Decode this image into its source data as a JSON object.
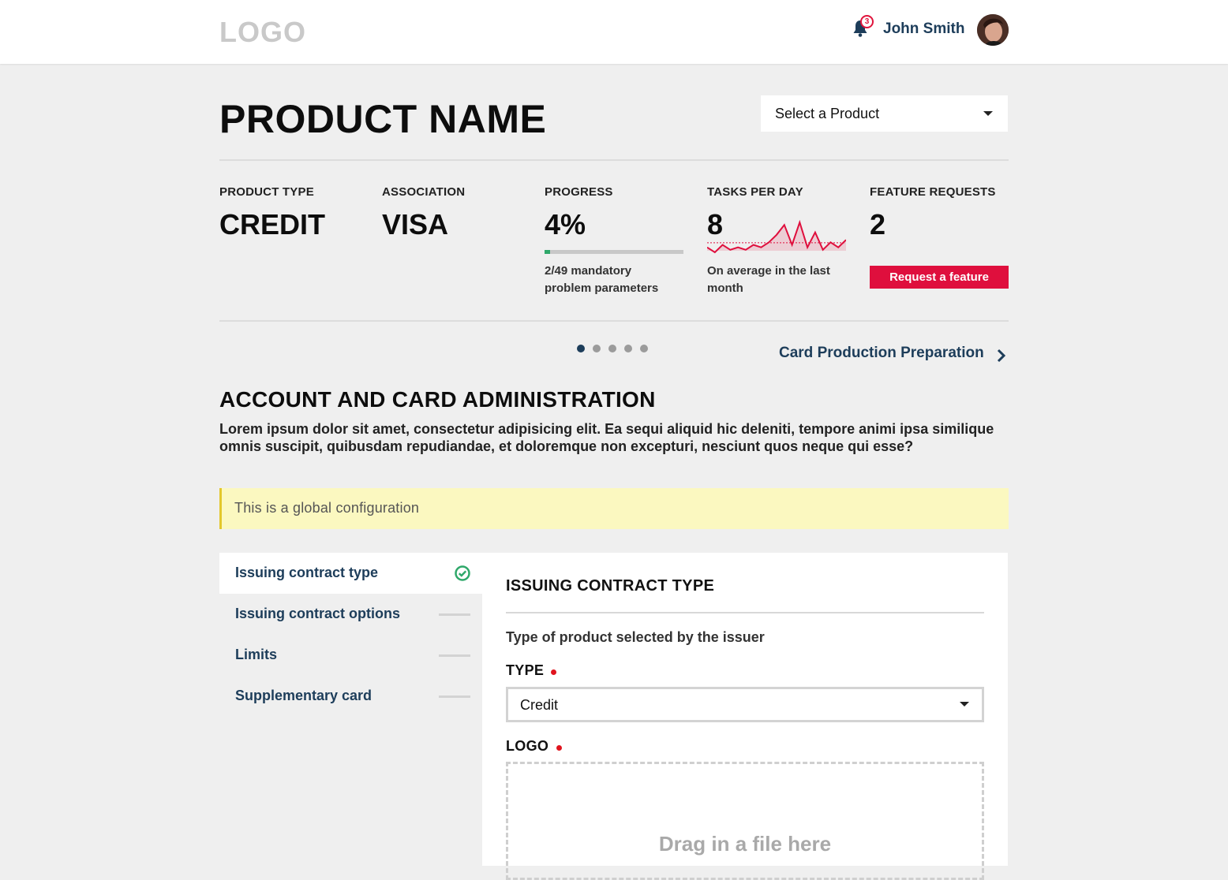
{
  "header": {
    "logo": "LOGO",
    "notification_count": "3",
    "username": "John Smith"
  },
  "product": {
    "title": "PRODUCT NAME",
    "select_label": "Select a Product"
  },
  "stats": {
    "product_type": {
      "label": "PRODUCT TYPE",
      "value": "CREDIT"
    },
    "association": {
      "label": "ASSOCIATION",
      "value": "VISA"
    },
    "progress": {
      "label": "PROGRESS",
      "value": "4%",
      "fraction": 0.04,
      "note_line1": "2/49 mandatory",
      "note_line2": "problem parameters"
    },
    "tasks": {
      "label": "TASKS PER DAY",
      "value": "8",
      "note_line1": "On average in the last",
      "note_line2": "month",
      "sparkline": [
        3,
        1,
        4,
        2,
        3,
        2,
        4,
        3,
        5,
        8,
        12,
        4,
        13,
        3,
        9,
        2,
        5,
        3,
        6
      ]
    },
    "features": {
      "label": "FEATURE REQUESTS",
      "value": "2",
      "button": "Request a feature"
    }
  },
  "pager": {
    "dot_count": 5,
    "active_index": 0,
    "next_label": "Card Production Preparation"
  },
  "section": {
    "title": "ACCOUNT AND CARD ADMINISTRATION",
    "description": "Lorem ipsum dolor sit amet, consectetur adipisicing elit. Ea sequi aliquid hic deleniti, tempore animi ipsa similique omnis suscipit, quibusdam repudiandae, et doloremque non excepturi, nesciunt quos neque qui esse?",
    "notice": "This is a global configuration"
  },
  "steps": [
    {
      "label": "Issuing contract type",
      "status": "complete"
    },
    {
      "label": "Issuing contract options",
      "status": "pending"
    },
    {
      "label": "Limits",
      "status": "pending"
    },
    {
      "label": "Supplementary card",
      "status": "pending"
    }
  ],
  "panel": {
    "title": "ISSUING CONTRACT TYPE",
    "description": "Type of product selected by the issuer",
    "type_label": "TYPE",
    "type_value": "Credit",
    "logo_label": "LOGO",
    "dropzone_text": "Drag in a file here"
  },
  "colors": {
    "accent": "#df0f3d",
    "navy": "#1d3d5a",
    "success": "#2fa86a",
    "notice_bg": "#fbf8c0"
  }
}
